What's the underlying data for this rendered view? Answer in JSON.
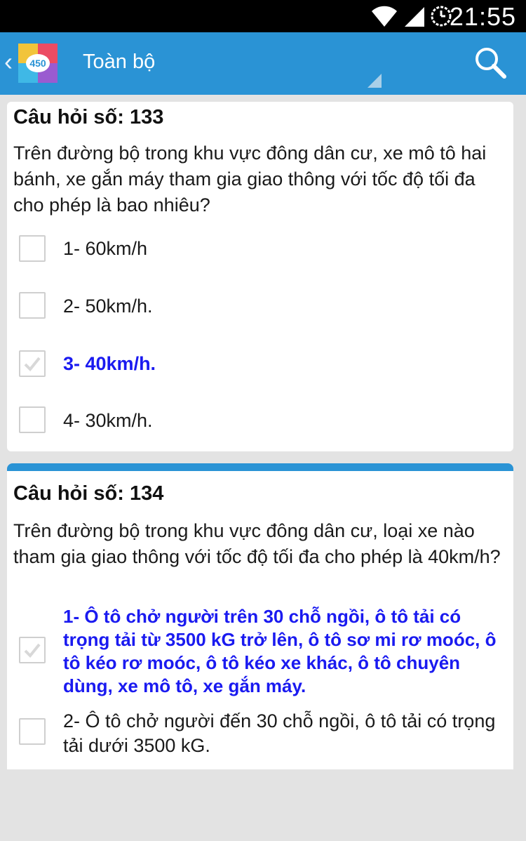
{
  "status_bar": {
    "time": "21:55"
  },
  "action_bar": {
    "title": "Toàn bộ",
    "logo_text": "450"
  },
  "questions": [
    {
      "title": "Câu hỏi số: 133",
      "text": "Trên đường bộ trong khu vực đông dân cư, xe mô tô hai bánh, xe gắn máy tham gia giao thông với tốc độ tối đa cho phép là bao nhiêu?",
      "options": [
        {
          "label": "1- 60km/h",
          "checked": false
        },
        {
          "label": "2- 50km/h.",
          "checked": false
        },
        {
          "label": "3- 40km/h.",
          "checked": true
        },
        {
          "label": "4- 30km/h.",
          "checked": false
        }
      ]
    },
    {
      "title": "Câu hỏi số: 134",
      "text": "Trên đường bộ trong khu vực đông dân cư, loại xe nào tham gia giao thông với tốc độ tối đa cho phép là 40km/h?",
      "options": [
        {
          "label": "1- Ô tô chở người trên 30 chỗ ngồi, ô tô tải có trọng tải từ 3500 kG trở lên, ô tô sơ mi rơ moóc, ô tô kéo rơ moóc, ô tô kéo xe khác, ô tô chuyên dùng, xe mô tô, xe gắn máy.",
          "checked": true
        },
        {
          "label": "2- Ô tô chở người đến 30 chỗ ngồi, ô tô tải có trọng tải dưới 3500 kG.",
          "checked": false
        }
      ]
    }
  ],
  "colors": {
    "accent": "#2a93d5",
    "selected_text": "#1a1af0",
    "background": "#e3e3e3"
  }
}
